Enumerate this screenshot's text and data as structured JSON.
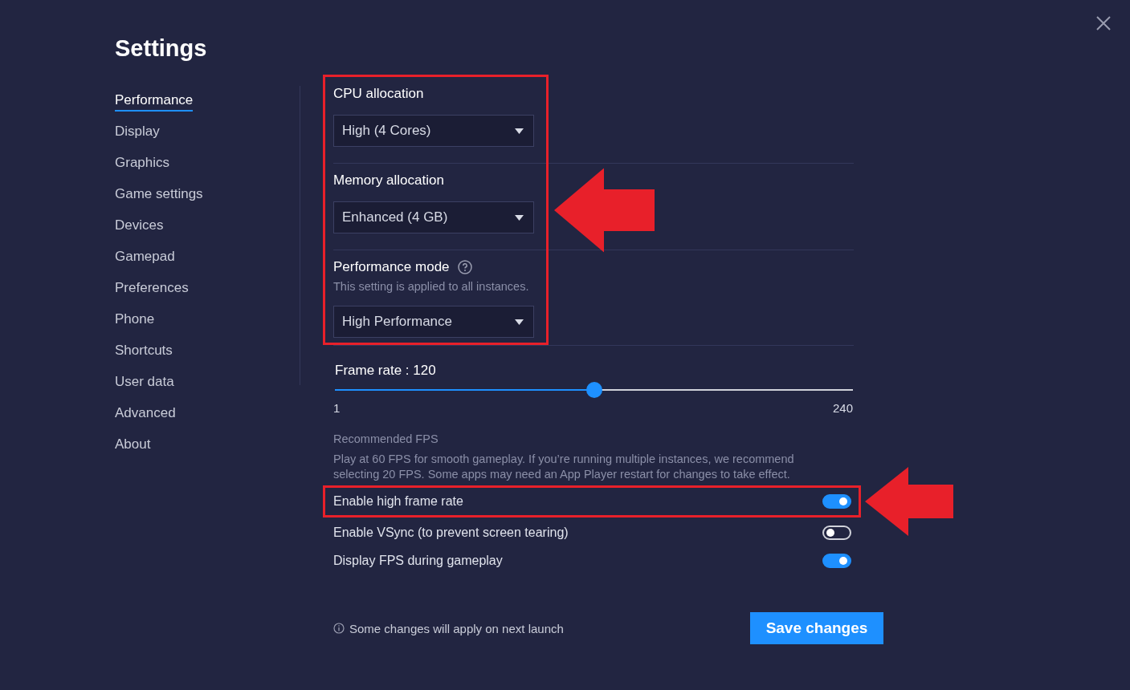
{
  "window": {
    "title": "Settings"
  },
  "sidebar": {
    "items": [
      {
        "label": "Performance",
        "selected": true
      },
      {
        "label": "Display",
        "selected": false
      },
      {
        "label": "Graphics",
        "selected": false
      },
      {
        "label": "Game settings",
        "selected": false
      },
      {
        "label": "Devices",
        "selected": false
      },
      {
        "label": "Gamepad",
        "selected": false
      },
      {
        "label": "Preferences",
        "selected": false
      },
      {
        "label": "Phone",
        "selected": false
      },
      {
        "label": "Shortcuts",
        "selected": false
      },
      {
        "label": "User data",
        "selected": false
      },
      {
        "label": "Advanced",
        "selected": false
      },
      {
        "label": "About",
        "selected": false
      }
    ]
  },
  "allocation_group": {
    "highlighted": true,
    "settings": [
      {
        "label": "CPU allocation",
        "value": "High (4 Cores)"
      },
      {
        "label": "Memory allocation",
        "value": "Enhanced (4 GB)"
      },
      {
        "label": "Performance mode",
        "help": true,
        "note": "This setting is applied to all instances.",
        "value": "High Performance"
      }
    ]
  },
  "frame_rate": {
    "label": "Frame rate : 120",
    "level": 0.5,
    "min": "1",
    "max": "240"
  },
  "recommended": {
    "title": "Recommended FPS",
    "text": "Play at 60 FPS for smooth gameplay. If you’re running multiple instances, we recommend selecting 20 FPS. Some apps may need an App Player restart for changes to take effect."
  },
  "toggles": [
    {
      "label": "Enable high frame rate",
      "on": true,
      "highlighted": true
    },
    {
      "label": "Enable VSync (to prevent screen tearing)",
      "on": false,
      "highlighted": false
    },
    {
      "label": "Display FPS during gameplay",
      "on": true,
      "highlighted": false
    }
  ],
  "footer": {
    "note": "Some changes will apply on next launch",
    "button": "Save changes"
  }
}
